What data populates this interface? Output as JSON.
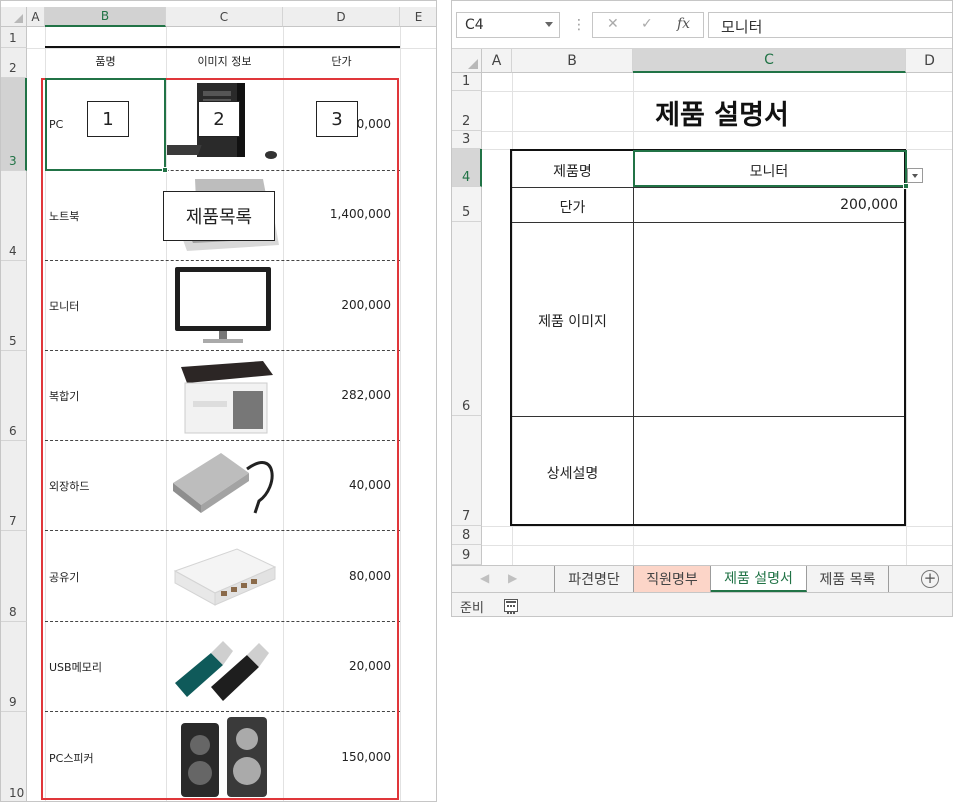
{
  "left": {
    "columns": [
      "A",
      "B",
      "C",
      "D",
      "E"
    ],
    "rows": [
      "1",
      "2",
      "3",
      "4",
      "5",
      "6",
      "7",
      "8",
      "9",
      "10"
    ],
    "headers": {
      "name": "품명",
      "image": "이미지 정보",
      "price": "단가"
    },
    "products": [
      {
        "name": "PC",
        "price": "1,400,000",
        "price_visible": "00,000",
        "icon": "desktop-pc-icon"
      },
      {
        "name": "노트북",
        "price": "1,400,000",
        "icon": "laptop-icon"
      },
      {
        "name": "모니터",
        "price": "200,000",
        "icon": "monitor-icon"
      },
      {
        "name": "복합기",
        "price": "282,000",
        "icon": "printer-icon"
      },
      {
        "name": "외장하드",
        "price": "40,000",
        "icon": "external-hdd-icon"
      },
      {
        "name": "공유기",
        "price": "80,000",
        "icon": "router-icon"
      },
      {
        "name": "USB메모리",
        "price": "20,000",
        "icon": "usb-drive-icon"
      },
      {
        "name": "PC스피커",
        "price": "150,000",
        "icon": "speaker-icon"
      }
    ],
    "callouts": {
      "c1": "1",
      "c2": "2",
      "c3": "3",
      "range_label": "제품목록"
    },
    "colors": {
      "range_border": "#e0363a",
      "selection": "#217346"
    }
  },
  "right": {
    "name_box": "C4",
    "formula_value": "모니터",
    "fb_cancel": "✕",
    "fb_enter": "✓",
    "fb_fx": "fx",
    "columns": [
      "A",
      "B",
      "C",
      "D"
    ],
    "rows": [
      "1",
      "2",
      "3",
      "4",
      "5",
      "6",
      "7",
      "8",
      "9"
    ],
    "title": "제품 설명서",
    "table": {
      "product_label": "제품명",
      "product_value": "모니터",
      "price_label": "단가",
      "price_value": "200,000",
      "image_label": "제품 이미지",
      "detail_label": "상세설명"
    },
    "sheets": [
      {
        "label": "파견명단"
      },
      {
        "label": "직원명부"
      },
      {
        "label": "제품 설명서"
      },
      {
        "label": "제품 목록"
      }
    ],
    "active_sheet": "제품 설명서",
    "nav_prev": "◀",
    "nav_next": "▶",
    "add_sheet": "+",
    "status": "준비"
  }
}
